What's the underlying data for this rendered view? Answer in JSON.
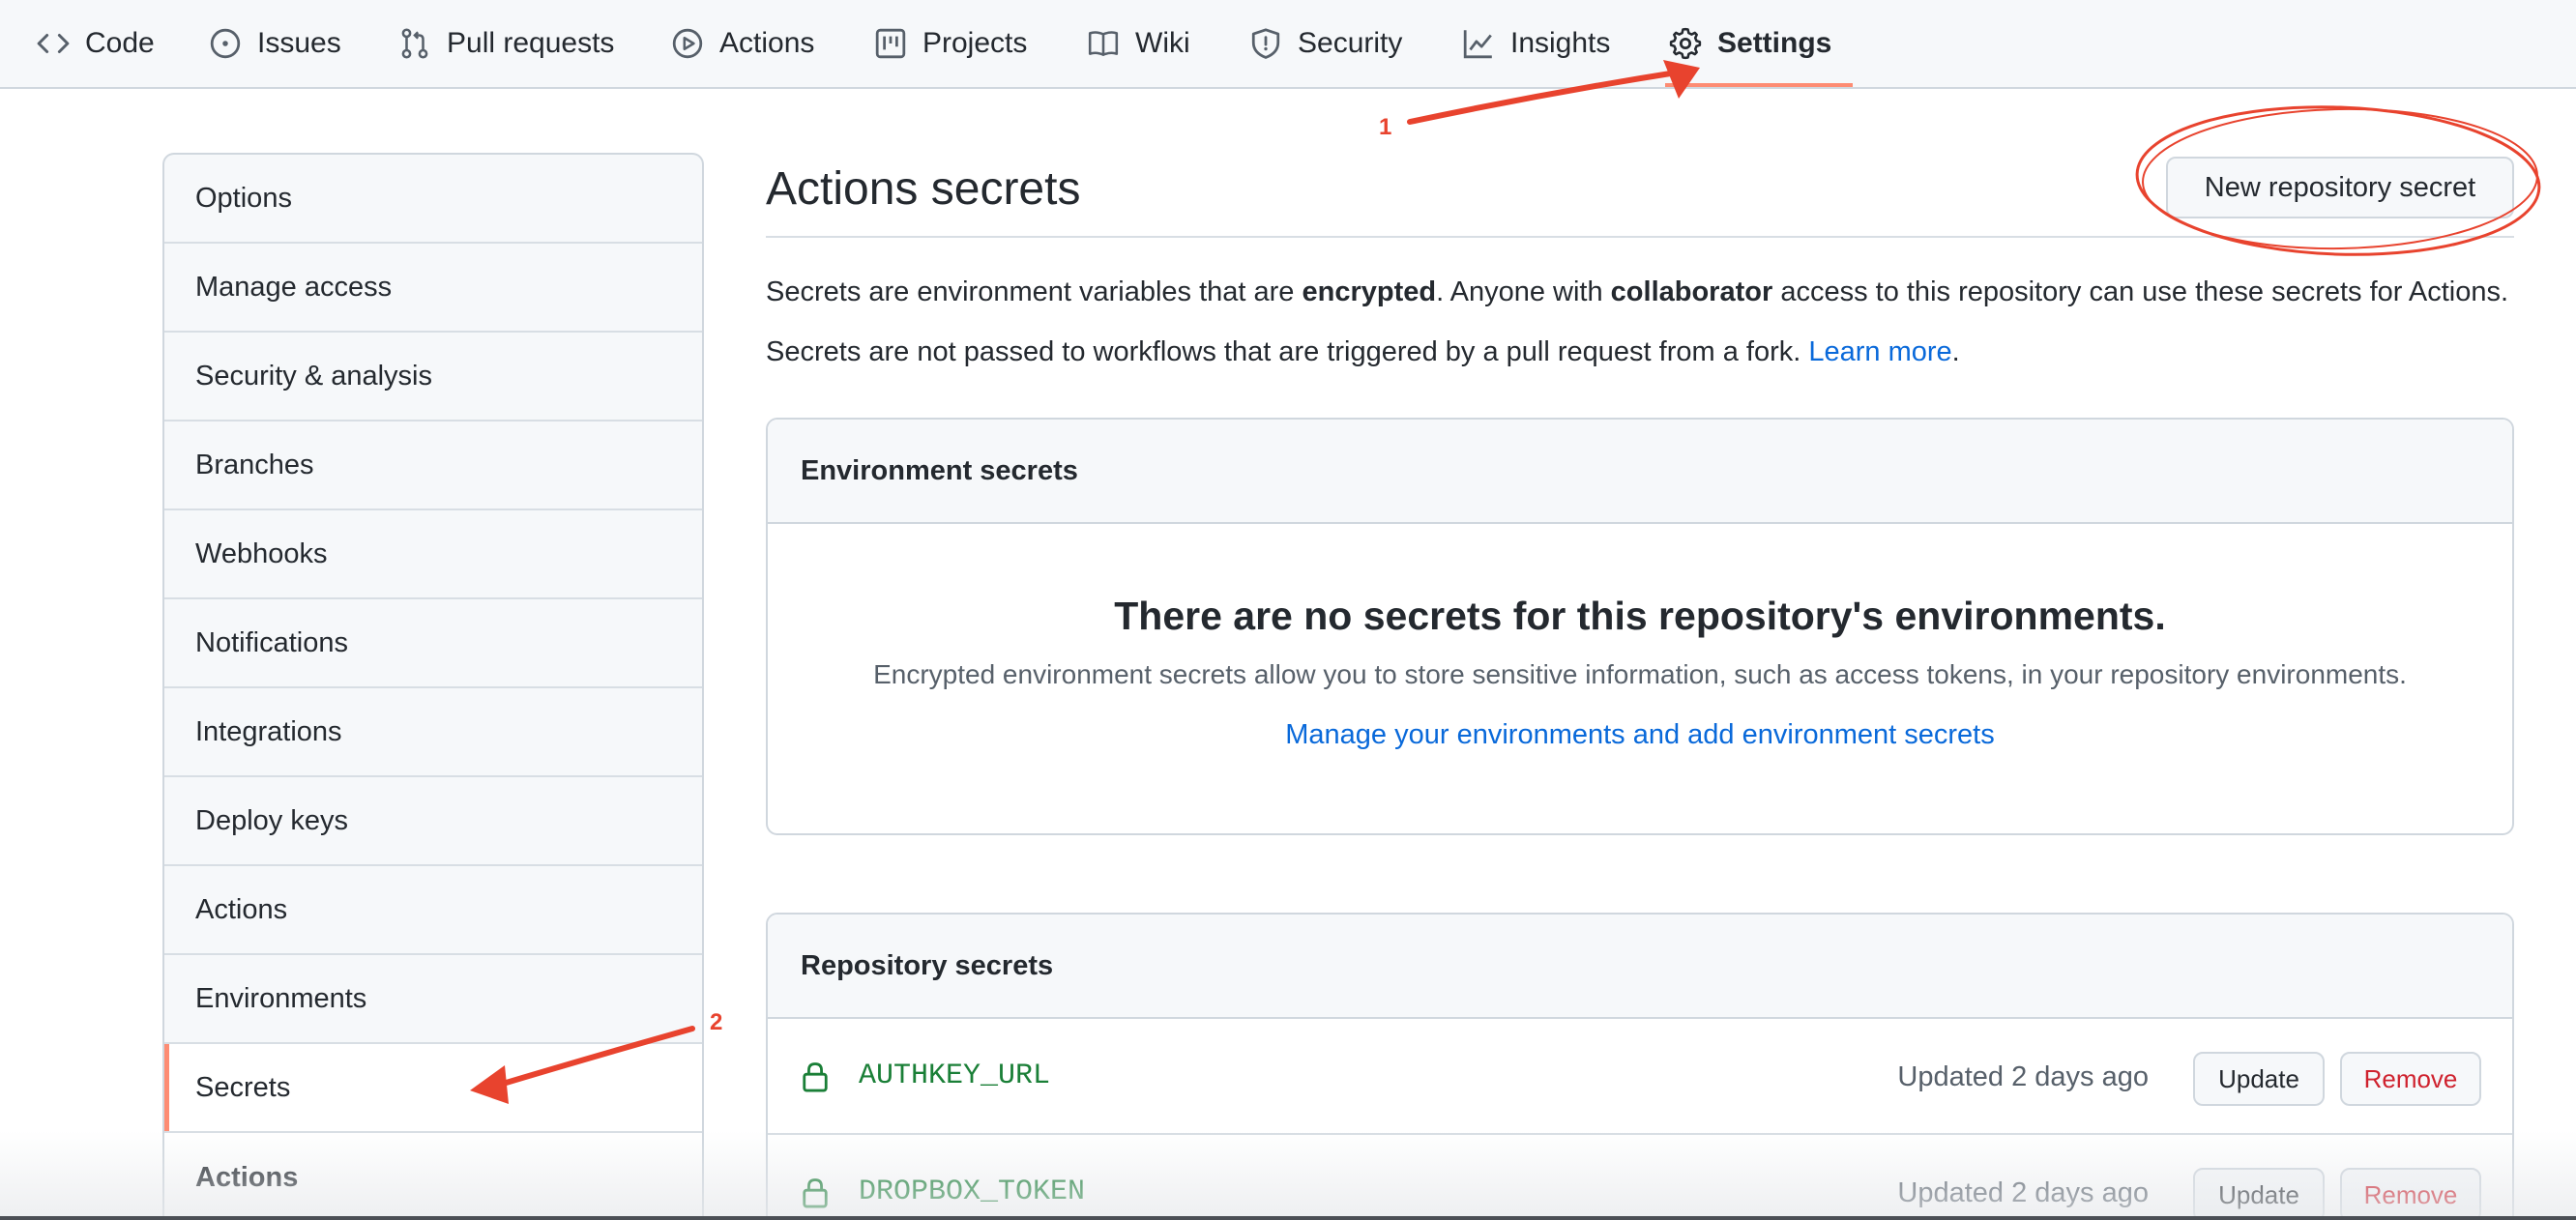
{
  "nav": {
    "tabs": [
      {
        "label": "Code",
        "icon": "code-icon"
      },
      {
        "label": "Issues",
        "icon": "issue-opened-icon"
      },
      {
        "label": "Pull requests",
        "icon": "git-pull-request-icon"
      },
      {
        "label": "Actions",
        "icon": "play-icon"
      },
      {
        "label": "Projects",
        "icon": "project-icon"
      },
      {
        "label": "Wiki",
        "icon": "book-icon"
      },
      {
        "label": "Security",
        "icon": "shield-icon"
      },
      {
        "label": "Insights",
        "icon": "graph-icon"
      },
      {
        "label": "Settings",
        "icon": "gear-icon",
        "selected": true
      }
    ]
  },
  "sidebar": {
    "items": [
      {
        "label": "Options"
      },
      {
        "label": "Manage access"
      },
      {
        "label": "Security & analysis"
      },
      {
        "label": "Branches"
      },
      {
        "label": "Webhooks"
      },
      {
        "label": "Notifications"
      },
      {
        "label": "Integrations"
      },
      {
        "label": "Deploy keys"
      },
      {
        "label": "Actions"
      },
      {
        "label": "Environments"
      },
      {
        "label": "Secrets",
        "selected": true
      }
    ],
    "section_heading": "Actions"
  },
  "main": {
    "title": "Actions secrets",
    "new_button": "New repository secret",
    "desc1": {
      "p1": "Secrets are environment variables that are ",
      "b1": "encrypted",
      "p2": ". Anyone with ",
      "b2": "collaborator",
      "p3": " access to this repository can use these secrets for Actions."
    },
    "desc2": {
      "text": "Secrets are not passed to workflows that are triggered by a pull request from a fork. ",
      "link": "Learn more",
      "end": "."
    },
    "environment_secrets": {
      "heading": "Environment secrets",
      "blank_title": "There are no secrets for this repository's environments.",
      "blank_desc": "Encrypted environment secrets allow you to store sensitive information, such as access tokens, in your repository environments.",
      "blank_link": "Manage your environments and add environment secrets"
    },
    "repository_secrets": {
      "heading": "Repository secrets",
      "rows": [
        {
          "name": "AUTHKEY_URL",
          "updated": "Updated 2 days ago",
          "update_label": "Update",
          "remove_label": "Remove"
        },
        {
          "name": "DROPBOX_TOKEN",
          "updated": "Updated 2 days ago",
          "update_label": "Update",
          "remove_label": "Remove"
        }
      ]
    }
  },
  "annotations": {
    "step1": "1",
    "step2": "2",
    "color": "#e8432e"
  },
  "colors": {
    "accent_link": "#0969da",
    "secret_name": "#1a7f37",
    "danger": "#cf222e",
    "selected_indicator": "#fd8c73"
  }
}
